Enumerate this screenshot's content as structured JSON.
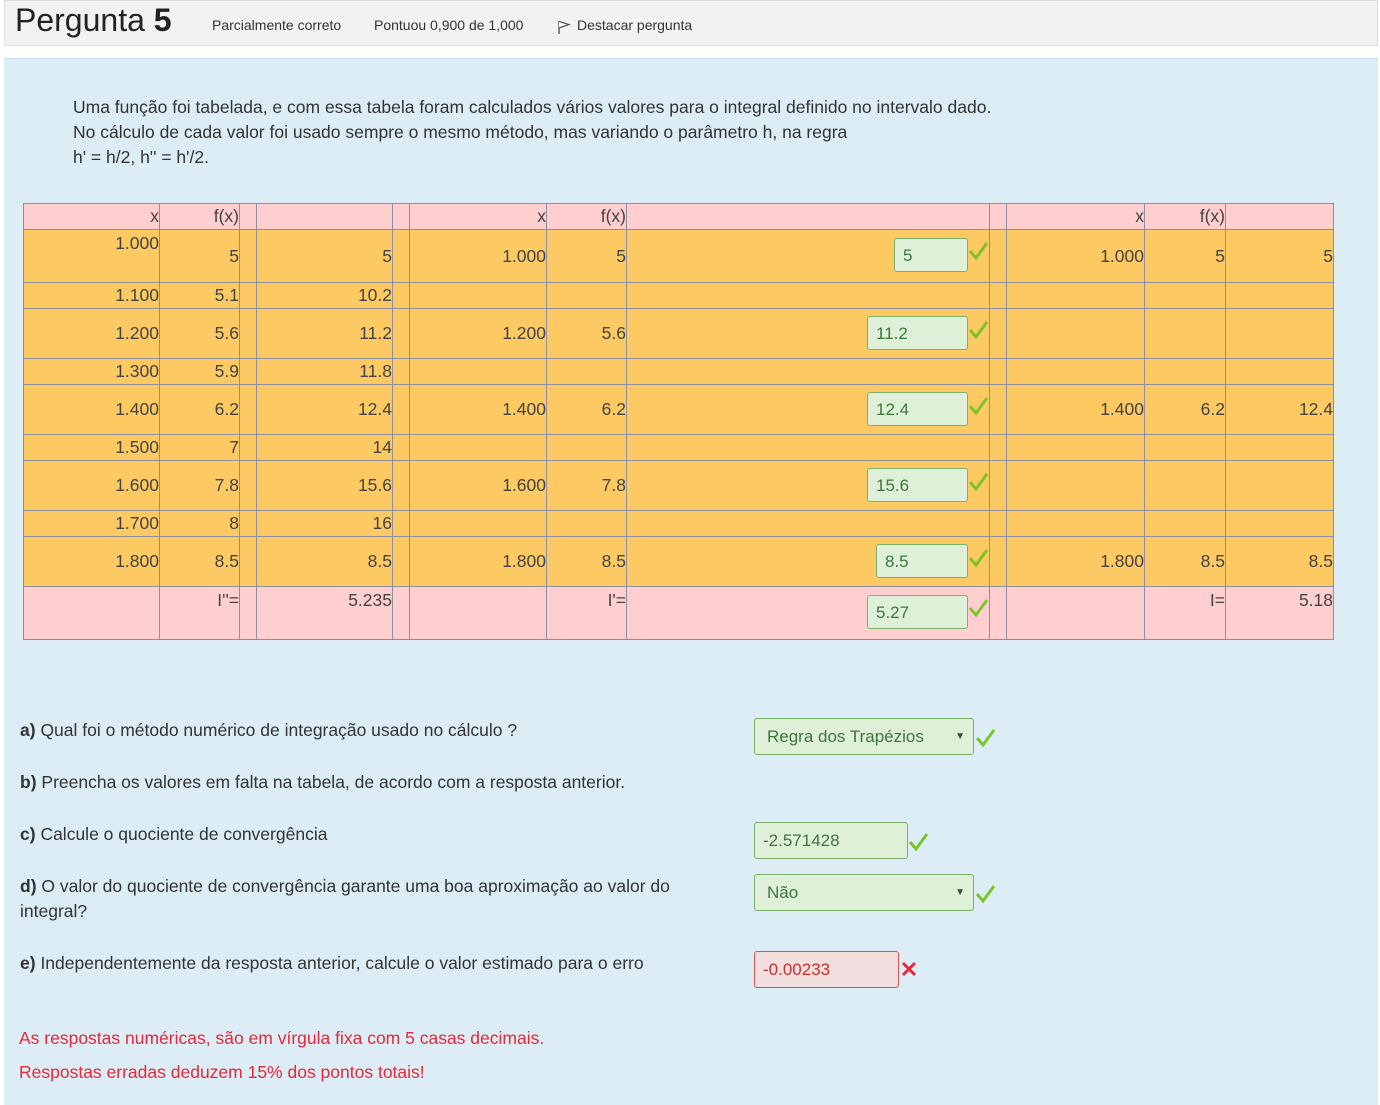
{
  "header": {
    "title_prefix": "Pergunta",
    "title_number": "5",
    "state": "Parcialmente correto",
    "grade": "Pontuou 0,900 de 1,000",
    "flag_label": "Destacar pergunta"
  },
  "intro": {
    "line1": "Uma função foi tabelada, e com essa tabela foram calculados vários valores para o integral definido no intervalo dado.",
    "line2": "No cálculo de cada valor foi usado sempre o mesmo método, mas variando o parâmetro h, na regra",
    "line3": "h' = h/2, h'' = h'/2."
  },
  "table": {
    "headers": {
      "x1": "x",
      "f1": "f(x)",
      "x2": "x",
      "f2": "f(x)",
      "x3": "x",
      "f3": "f(x)"
    },
    "rows": [
      {
        "a_x": "1.000",
        "a_f": "5",
        "a_w": "5",
        "b_x": "1.000",
        "b_f": "5",
        "b_w": "5",
        "c_x": "1.000",
        "c_f": "5",
        "c_w": "5"
      },
      {
        "a_x": "1.100",
        "a_f": "5.1",
        "a_w": "10.2"
      },
      {
        "a_x": "1.200",
        "a_f": "5.6",
        "a_w": "11.2",
        "b_x": "1.200",
        "b_f": "5.6",
        "b_w": "11.2"
      },
      {
        "a_x": "1.300",
        "a_f": "5.9",
        "a_w": "11.8"
      },
      {
        "a_x": "1.400",
        "a_f": "6.2",
        "a_w": "12.4",
        "b_x": "1.400",
        "b_f": "6.2",
        "b_w": "12.4",
        "c_x": "1.400",
        "c_f": "6.2",
        "c_w": "12.4"
      },
      {
        "a_x": "1.500",
        "a_f": "7",
        "a_w": "14"
      },
      {
        "a_x": "1.600",
        "a_f": "7.8",
        "a_w": "15.6",
        "b_x": "1.600",
        "b_f": "7.8",
        "b_w": "15.6"
      },
      {
        "a_x": "1.700",
        "a_f": "8",
        "a_w": "16"
      },
      {
        "a_x": "1.800",
        "a_f": "8.5",
        "a_w": "8.5",
        "b_x": "1.800",
        "b_f": "8.5",
        "b_w": "8.5",
        "c_x": "1.800",
        "c_f": "8.5",
        "c_w": "8.5"
      }
    ],
    "footer": {
      "a_label": "I''=",
      "a_value": "5.235",
      "b_label": "I'=",
      "b_value": "5.27",
      "c_label": "I=",
      "c_value": "5.18"
    }
  },
  "questions": {
    "a": {
      "letter": "a)",
      "text": "Qual foi o método numérico de integração usado no cálculo ?",
      "answer": "Regra dos Trapézios"
    },
    "b": {
      "letter": "b)",
      "text": "Preencha os valores em falta na tabela, de acordo com a resposta anterior."
    },
    "c": {
      "letter": "c)",
      "text": "Calcule o quociente de convergência",
      "answer": "-2.571428"
    },
    "d": {
      "letter": "d)",
      "text": "O valor do quociente de convergência garante uma boa aproximação ao valor do",
      "text2": "integral?",
      "answer": "Não"
    },
    "e": {
      "letter": "e)",
      "text": "Independentemente da resposta anterior, calcule o valor estimado para o erro",
      "answer": "-0.00233"
    }
  },
  "notes": {
    "line1": "As respostas numéricas, são em vírgula fixa com 5 casas decimais.",
    "line2": "Respostas erradas deduzem 15% dos pontos totais!"
  },
  "colors": {
    "table_header": "#ffcece",
    "table_body": "#fcc962",
    "correct": "#7cc427",
    "incorrect": "#e5283a",
    "panel": "#dcedf6"
  },
  "icons": {
    "flag": "flag-icon",
    "correct": "checkmark-icon",
    "incorrect": "cross-icon",
    "dropdown": "caret-down-icon"
  }
}
